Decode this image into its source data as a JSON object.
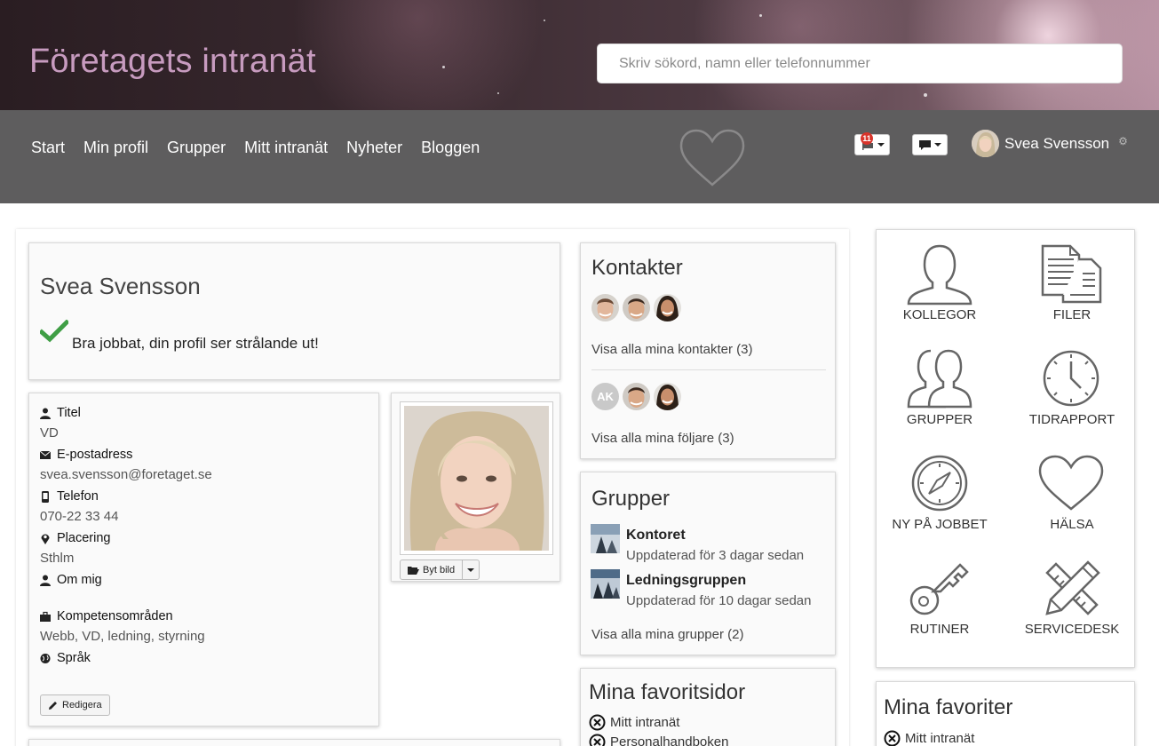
{
  "header": {
    "site_title": "Företagets intranät",
    "search_placeholder": "Skriv sökord, namn eller telefonnummer"
  },
  "nav": {
    "links": [
      "Start",
      "Min profil",
      "Grupper",
      "Mitt intranät",
      "Nyheter",
      "Bloggen"
    ],
    "notifications_count": "11",
    "user_name": "Svea Svensson"
  },
  "profile": {
    "name": "Svea Svensson",
    "message": "Bra jobbat, din profil ser strålande ut!",
    "fields": [
      {
        "label": "Titel",
        "value": "VD",
        "icon": "user-icon"
      },
      {
        "label": "E-postadress",
        "value": "svea.svensson@foretaget.se",
        "icon": "envelope-icon"
      },
      {
        "label": "Telefon",
        "value": "070-22 33 44",
        "icon": "phone-icon"
      },
      {
        "label": "Placering",
        "value": "Sthlm",
        "icon": "map-marker-icon"
      },
      {
        "label": "Om mig",
        "value": "",
        "icon": "user-icon"
      },
      {
        "label": "Kompetensområden",
        "value": "Webb, VD, ledning, styrning",
        "icon": "briefcase-icon"
      },
      {
        "label": "Språk",
        "value": "",
        "icon": "globe-icon"
      }
    ],
    "edit_label": "Redigera",
    "change_photo_label": "Byt bild"
  },
  "contacts": {
    "title": "Kontakter",
    "all_contacts": "Visa alla mina kontakter (3)",
    "follower_initials": "AK",
    "all_followers": "Visa alla mina följare (3)"
  },
  "groups": {
    "title": "Grupper",
    "items": [
      {
        "name": "Kontoret",
        "updated": "Uppdaterad för 3 dagar sedan"
      },
      {
        "name": "Ledningsgruppen",
        "updated": "Uppdaterad för 10 dagar sedan"
      }
    ],
    "all_groups": "Visa alla mina grupper (2)"
  },
  "favorite_pages": {
    "title": "Mina favoritsidor",
    "items": [
      "Mitt intranät",
      "Personalhandboken"
    ]
  },
  "shortcuts": [
    {
      "label": "KOLLEGOR",
      "icon": "colleague-icon"
    },
    {
      "label": "FILER",
      "icon": "files-icon"
    },
    {
      "label": "GRUPPER",
      "icon": "groups-icon"
    },
    {
      "label": "TIDRAPPORT",
      "icon": "clock-icon"
    },
    {
      "label": "NY PÅ JOBBET",
      "icon": "compass-icon"
    },
    {
      "label": "HÄLSA",
      "icon": "heart-icon"
    },
    {
      "label": "RUTINER",
      "icon": "key-icon"
    },
    {
      "label": "SERVICEDESK",
      "icon": "pencil-ruler-icon"
    }
  ],
  "favorites": {
    "title": "Mina favoriter",
    "items": [
      "Mitt intranät"
    ]
  },
  "colors": {
    "title_pink": "#c79bbf",
    "nav_gray": "#5e5d5e",
    "check_green": "#3f9e45",
    "badge_red": "#d9342b"
  }
}
